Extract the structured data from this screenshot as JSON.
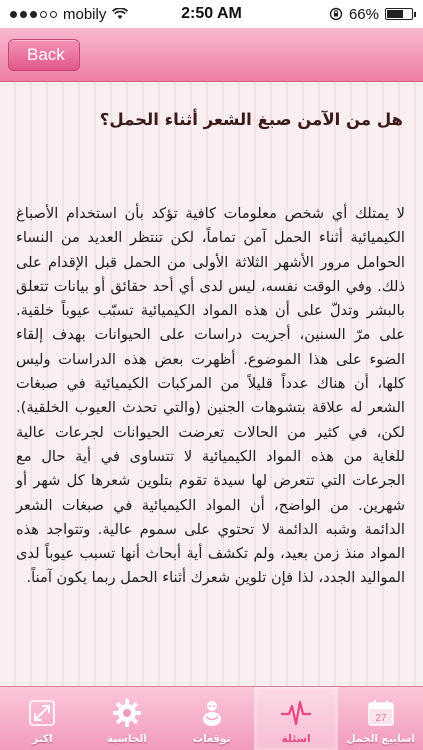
{
  "status_bar": {
    "carrier": "mobily",
    "time": "2:50 AM",
    "battery_percent": "66%",
    "battery_level": 0.66
  },
  "nav": {
    "back_label": "Back"
  },
  "article": {
    "title": "هل من الآمن صبغ الشعر أثناء الحمل؟",
    "body": "لا يمتلك أي شخص معلومات كافية تؤكد بأن استخدام الأصباغ الكيميائية أثناء الحمل آمن تماماً، لكن تنتظر العديد من النساء الحوامل مرور الأشهر الثلاثة الأولى من الحمل قبل الإقدام على ذلك. وفي الوقت نفسه، ليس لدى أي أحد حقائق أو بيانات تتعلق بالبشر وتدلّ على أن هذه المواد الكيميائية تسبّب عيوباً خلقية. على مرّ السنين، أجريت دراسات على الحيوانات بهدف إلقاء الضوء على هذا الموضوع. أظهرت بعض هذه الدراسات وليس كلها، أن هناك عدداً قليلاً من المركبات الكيميائية في صبغات الشعر له علاقة بتشوهات الجنين (والتي تحدث العيوب الخلقية). لكن، في كثير من الحالات تعرضت الحيوانات لجرعات عالية للغاية من هذه المواد الكيميائية لا تتساوى في أية حال مع الجرعات التي تتعرض لها سيدة تقوم بتلوين شعرها كل شهر أو شهرين. من الواضح، أن المواد الكيميائية في صبغات الشعر الدائمة وشبه الدائمة لا تحتوي على سموم عالية. وتتواجد هذه المواد منذ زمن بعيد، ولم تكشف أية أبحاث أنها تسبب عيوباً لدى المواليد الجدد، لذا فإن تلوين شعرك أثناء الحمل ربما يكون آمناً."
  },
  "tabs": [
    {
      "label": "اسابيع الحمل",
      "icon": "calendar-icon",
      "calendar_day": "27"
    },
    {
      "label": "اسئلة",
      "icon": "heartbeat-icon"
    },
    {
      "label": "توقعات",
      "icon": "baby-icon"
    },
    {
      "label": "الحاسبة",
      "icon": "gear-icon"
    },
    {
      "label": "اكثر",
      "icon": "expand-icon"
    }
  ],
  "active_tab": 1,
  "colors": {
    "nav_pink": "#ee7ea4",
    "tab_pink": "#f29bbd",
    "active_tab_label": "#e8467e"
  }
}
